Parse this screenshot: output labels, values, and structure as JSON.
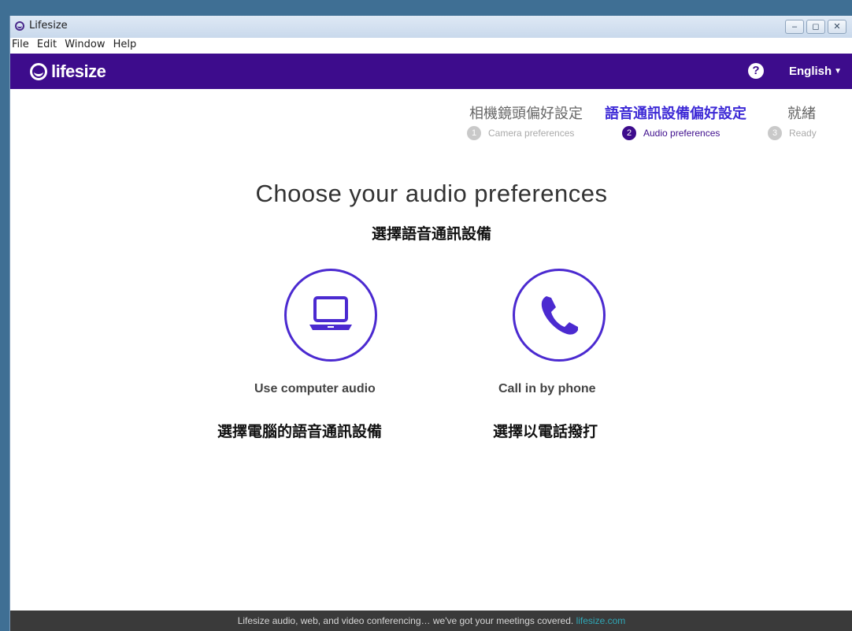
{
  "window": {
    "title": "Lifesize",
    "buttons": {
      "minimize": "–",
      "restore": "◻",
      "close": "✕"
    }
  },
  "menu": [
    "File",
    "Edit",
    "Window",
    "Help"
  ],
  "header": {
    "logo_text": "lifesize",
    "help_symbol": "?",
    "language": "English"
  },
  "steps_zh": [
    "相機鏡頭偏好設定",
    "語音通訊設備偏好設定",
    "就緒"
  ],
  "steps": [
    {
      "num": "1",
      "label": "Camera preferences",
      "active": false
    },
    {
      "num": "2",
      "label": "Audio preferences",
      "active": true
    },
    {
      "num": "3",
      "label": "Ready",
      "active": false
    }
  ],
  "main": {
    "heading": "Choose your audio preferences",
    "heading_zh": "選擇語音通訊設備",
    "options": [
      {
        "label": "Use computer audio",
        "label_zh": "選擇電腦的語音通訊設備",
        "icon": "laptop-icon"
      },
      {
        "label": "Call in by phone",
        "label_zh": "選擇以電話撥打",
        "icon": "phone-icon"
      }
    ]
  },
  "footer": {
    "text": "Lifesize audio, web, and video conferencing… we've got your meetings covered.",
    "link": "lifesize.com"
  },
  "colors": {
    "brand": "#3d0c8c",
    "accent": "#4b2ad0",
    "footer_bg": "#3a3a3a",
    "link": "#2fa7b6"
  }
}
